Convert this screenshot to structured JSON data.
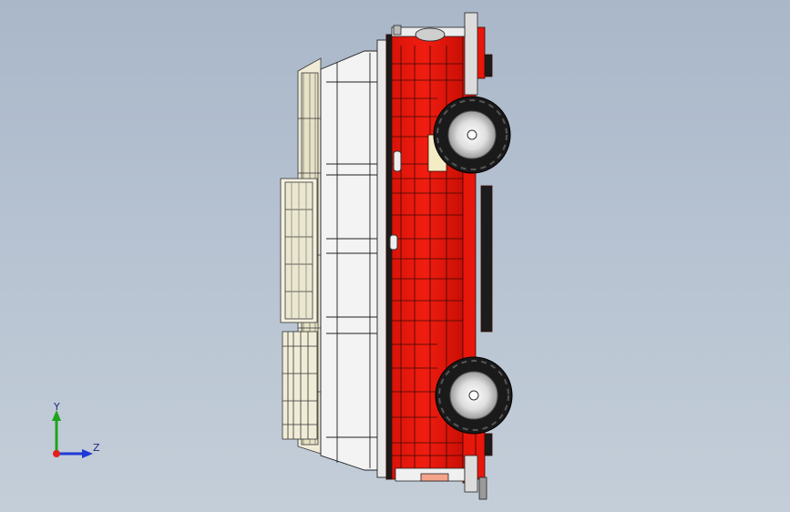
{
  "viewport": {
    "background_top": "#a9b7c9",
    "background_bottom": "#c4ced9"
  },
  "model": {
    "body_color": "#e8170b",
    "roof_color": "#f2f2f2",
    "rack_color": "#ece8d2",
    "tire_color": "#1a1a1a",
    "hub_color": "#e6e6e6",
    "outline_color": "#222222"
  },
  "triad": {
    "y_label": "Y",
    "z_label": "Z",
    "y_color": "#1fa31f",
    "z_color": "#1e3ad6",
    "origin_color": "#e02020"
  }
}
